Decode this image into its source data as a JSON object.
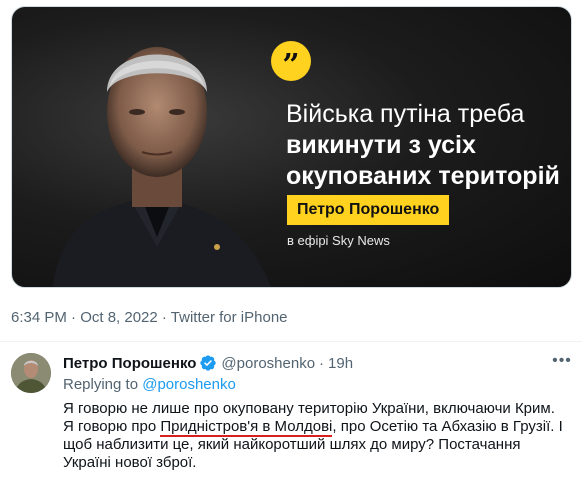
{
  "media": {
    "quote_mark": "”",
    "headline_line1": "Війська путіна треба",
    "headline_line2": "викинути з усіх",
    "headline_line3": "окупованих територій",
    "name_plate": "Петро Порошенко",
    "on_air": "в ефірі Sky News",
    "colors": {
      "accent": "#ffd21f",
      "background": "#161616"
    }
  },
  "meta": {
    "text": "6:34 PM · Oct 8, 2022 · Twitter for iPhone"
  },
  "reply": {
    "author_name": "Петро Порошенко",
    "handle": "@poroshenko",
    "separator": "·",
    "time": "19h",
    "more_icon": "•••",
    "replying_label": "Replying to",
    "replying_handle": "@poroshenko",
    "body_part1": "Я говорю не лише про окуповану територію України, включаючи Крим. Я говорю про ",
    "body_underlined": "Придністров'я в Молдові",
    "body_part2": ", про Осетію та Абхазію в Грузії. І щоб наблизити це, який найкоротший шлях до миру? Постачання Україні нової зброї."
  }
}
